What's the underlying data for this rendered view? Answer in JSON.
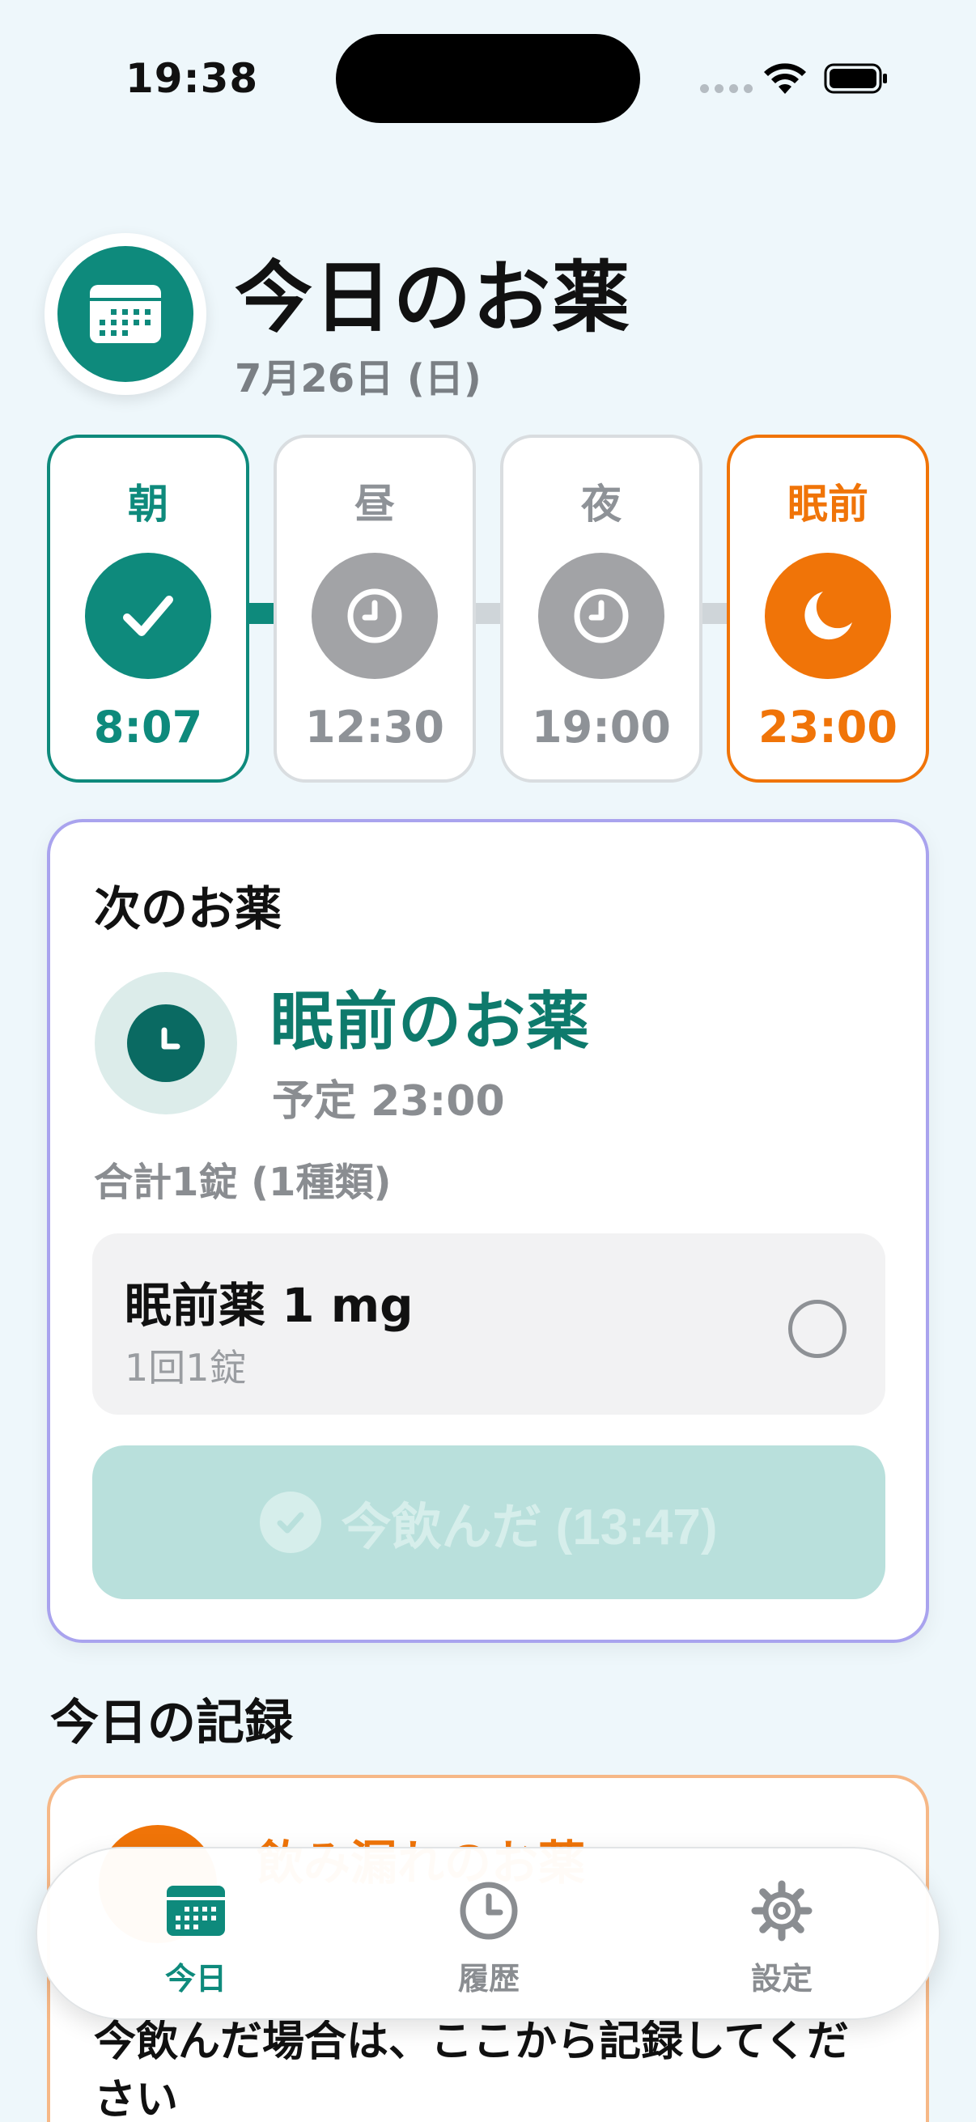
{
  "status_bar": {
    "time": "19:38"
  },
  "header": {
    "title": "今日のお薬",
    "date": "7月26日 (日)",
    "icon": "calendar-icon"
  },
  "schedule": [
    {
      "label": "朝",
      "time": "8:07",
      "state": "done",
      "icon": "checkmark-icon"
    },
    {
      "label": "昼",
      "time": "12:30",
      "state": "pending",
      "icon": "clock-icon"
    },
    {
      "label": "夜",
      "time": "19:00",
      "state": "pending",
      "icon": "clock-icon"
    },
    {
      "label": "眠前",
      "time": "23:00",
      "state": "next",
      "icon": "moon-icon"
    }
  ],
  "next_card": {
    "title": "次のお薬",
    "name": "眠前のお薬",
    "scheduled": "予定 23:00",
    "total": "合計1錠 (1種類)",
    "medicine": {
      "name": "眠前薬 1 mg",
      "dose": "1回1錠"
    },
    "take_button": "今飲んだ (13:47)"
  },
  "record": {
    "heading": "今日の記録",
    "missed_title": "飲み漏れのお薬",
    "missed_text": "今飲んだ場合は、ここから記録してください"
  },
  "tabs": [
    {
      "label": "今日",
      "icon": "calendar-icon",
      "active": true
    },
    {
      "label": "履歴",
      "icon": "clock-icon",
      "active": false
    },
    {
      "label": "設定",
      "icon": "gear-icon",
      "active": false
    }
  ],
  "colors": {
    "accent_teal": "#0e8a7c",
    "accent_orange": "#f07408",
    "pending_gray": "#a2a3a6",
    "next_card_border": "#a9a3ee",
    "button_disabled": "#b9e0dc"
  }
}
